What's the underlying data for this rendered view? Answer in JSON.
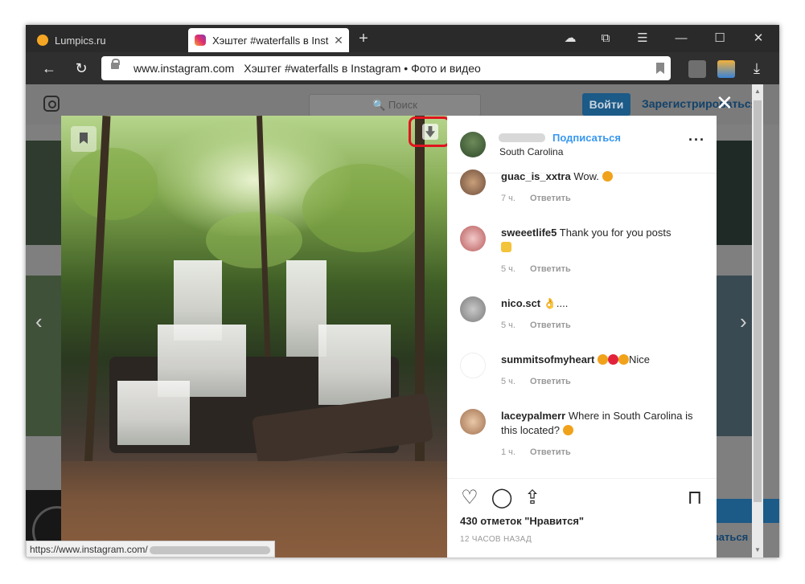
{
  "browser": {
    "tabs": [
      {
        "label": "Lumpics.ru"
      },
      {
        "label": "Хэштег #waterfalls в Inst"
      }
    ],
    "new_tab_symbol": "+",
    "url": "www.instagram.com",
    "page_title": "Хэштег #waterfalls в Instagram • Фото и видео",
    "window_controls": {
      "minimize": "—",
      "maximize": "☐",
      "close": "✕"
    },
    "status_url": "https://www.instagram.com/"
  },
  "background_page": {
    "search_placeholder": "Поиск",
    "login_label": "Войти",
    "register_label": "Зарегистрироваться",
    "register_label_partial": "оваться"
  },
  "post": {
    "author_location": "South Carolina",
    "follow_label": "Подписаться",
    "more_label": "···",
    "comments": [
      {
        "user": "guac_is_xxtra",
        "text": "Wow.",
        "time": "7 ч.",
        "reply": "Ответить"
      },
      {
        "user": "sweeetlife5",
        "text": "Thank you for you posts",
        "time": "5 ч.",
        "reply": "Ответить"
      },
      {
        "user": "nico.sct",
        "text": "👌....",
        "time": "5 ч.",
        "reply": "Ответить"
      },
      {
        "user": "summitsofmyheart",
        "text": "Nice",
        "time": "5 ч.",
        "reply": "Ответить"
      },
      {
        "user": "laceypalmerr",
        "text": "Where in South Carolina is this located?",
        "time": "1 ч.",
        "reply": "Ответить"
      }
    ],
    "likes": "430 отметок \"Нравится\"",
    "posted": "12 ЧАСОВ НАЗАД"
  },
  "colors": {
    "accent": "#3897f0",
    "highlight_box": "#e0141e",
    "overlay": "#7f7f7f"
  },
  "icons": [
    "back-icon",
    "reload-icon",
    "lock-icon",
    "bookmark-icon",
    "download-icon",
    "heart-icon",
    "comment-icon",
    "share-icon",
    "save-icon",
    "close-icon",
    "chevron-left-icon",
    "chevron-right-icon"
  ]
}
